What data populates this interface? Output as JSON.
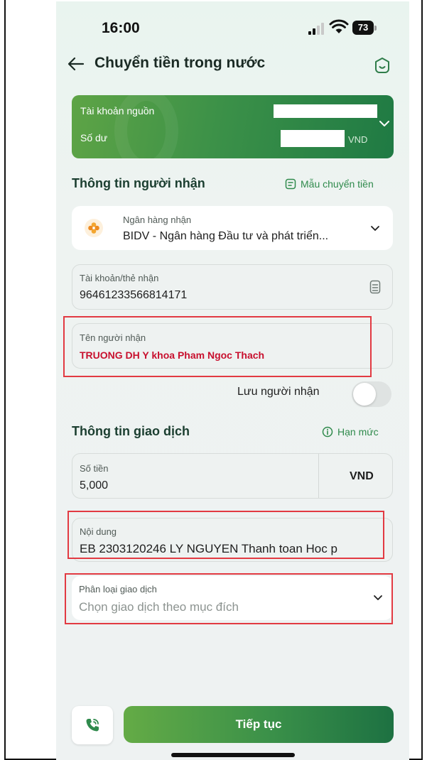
{
  "status_bar": {
    "time": "16:00",
    "battery": "73"
  },
  "header": {
    "title": "Chuyển tiền trong nước"
  },
  "source_account": {
    "account_label": "Tài khoản nguồn",
    "balance_label": "Số dư",
    "currency": "VND"
  },
  "recipient_section": {
    "title": "Thông tin người nhận",
    "template_link": "Mẫu chuyển tiền",
    "bank": {
      "label": "Ngân hàng nhận",
      "value": "BIDV - Ngân hàng Đầu tư và phát triển..."
    },
    "account": {
      "label": "Tài khoản/thẻ nhận",
      "value": "96461233566814171"
    },
    "name": {
      "label": "Tên người nhận",
      "value": "TRUONG DH Y khoa Pham Ngoc Thach"
    },
    "save_label": "Lưu người nhận"
  },
  "transaction_section": {
    "title": "Thông tin giao dịch",
    "limit_link": "Hạn mức",
    "amount": {
      "label": "Số tiền",
      "value": "5,000",
      "currency": "VND"
    },
    "content": {
      "label": "Nội dung",
      "value": "EB 2303120246 LY NGUYEN Thanh toan Hoc p"
    },
    "category": {
      "label": "Phân loại giao dịch",
      "placeholder": "Chọn giao dịch theo mục đích"
    }
  },
  "footer": {
    "continue_label": "Tiếp tục"
  },
  "colors": {
    "brand_green": "#3a9049",
    "dark_green": "#1d7142",
    "accent_red": "#e23a42",
    "recipient_name_red": "#c8102e"
  }
}
